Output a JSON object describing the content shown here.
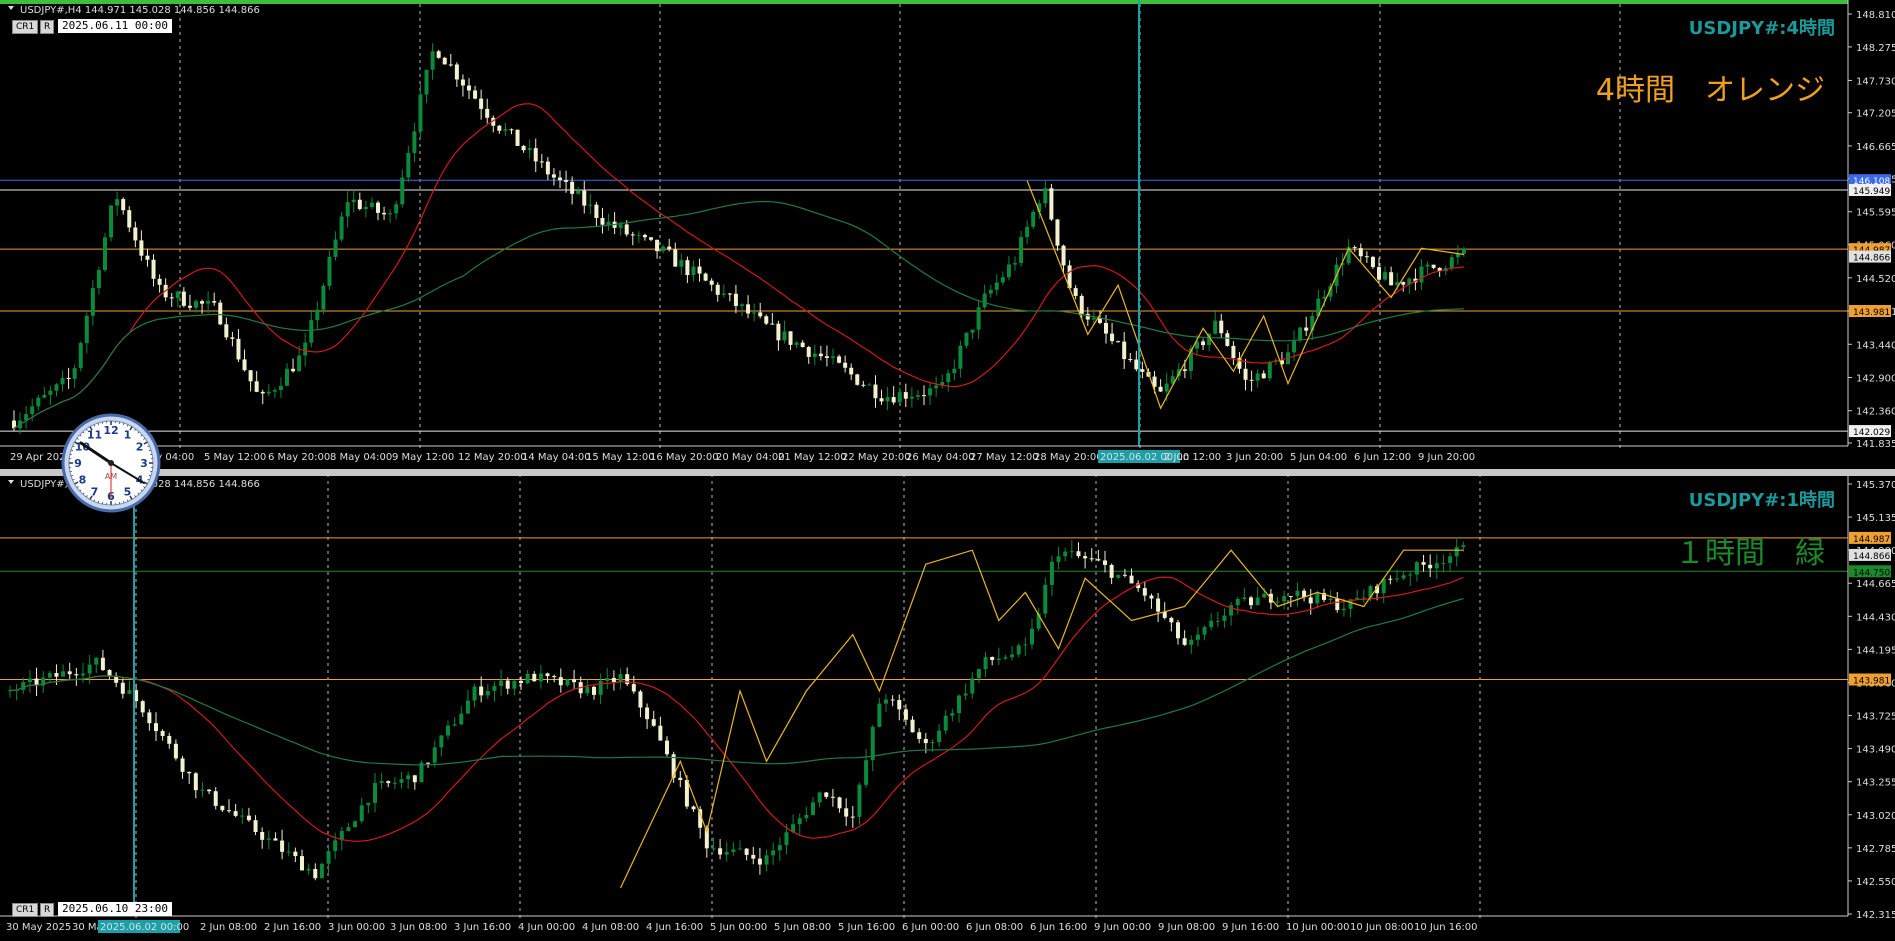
{
  "top": {
    "symbol_info": "USDJPY#,H4  144.971 145.028 144.856 144.866",
    "button_cr": "CR1",
    "button_r": "R",
    "time_box": "2025.06.11 00:00",
    "overlay_title": "USDJPY#:4時間",
    "overlay_note": "4時間　オレンジ",
    "prices": [
      "148.810",
      "148.275",
      "147.730",
      "147.205",
      "146.665",
      "146.135",
      "145.595",
      "145.060",
      "144.520",
      "143.981",
      "143.440",
      "142.900",
      "142.360",
      "141.835"
    ],
    "price_tags": {
      "blue": "146.108",
      "white_top": "145.949",
      "orange_top": "144.987",
      "current": "144.866",
      "orange_bot": "143.981",
      "white_bot": "142.029"
    },
    "dates": [
      "29 Apr 2025",
      "1 May 04:00",
      "5 May 12:00",
      "6 May 20:00",
      "8 May 04:00",
      "9 May 12:00",
      "12 May 20:00",
      "14 May 04:00",
      "15 May 12:00",
      "16 May 20:00",
      "20 May 04:00",
      "21 May 12:00",
      "22 May 20:00",
      "26 May 04:00",
      "27 May 12:00",
      "28 May 20:00",
      "2025.06.02 00:00",
      "2 Jun 12:00",
      "3 Jun 20:00",
      "5 Jun 04:00",
      "6 Jun 12:00",
      "9 Jun 20:00"
    ]
  },
  "bottom": {
    "symbol_info": "USDJPY#,H1  144.971 145.028 144.856 144.866",
    "button_cr": "CR1",
    "button_r": "R",
    "time_box": "2025.06.10 23:00",
    "overlay_title": "USDJPY#:1時間",
    "overlay_note": "１時間　緑",
    "prices": [
      "145.370",
      "145.135",
      "144.900",
      "144.665",
      "144.430",
      "144.195",
      "143.960",
      "143.725",
      "143.490",
      "143.255",
      "143.020",
      "142.785",
      "142.550",
      "142.315"
    ],
    "price_tags": {
      "orange_top": "144.987",
      "current": "144.866",
      "green": "144.750",
      "orange_bot": "143.981"
    },
    "dates": [
      "30 May 2025",
      "30 May 23:00",
      "2025.06.02 00:00",
      "2 Jun 08:00",
      "2 Jun 16:00",
      "3 Jun 00:00",
      "3 Jun 08:00",
      "3 Jun 16:00",
      "4 Jun 00:00",
      "4 Jun 08:00",
      "4 Jun 16:00",
      "5 Jun 00:00",
      "5 Jun 08:00",
      "5 Jun 16:00",
      "6 Jun 00:00",
      "6 Jun 08:00",
      "6 Jun 16:00",
      "9 Jun 00:00",
      "9 Jun 08:00",
      "9 Jun 16:00",
      "10 Jun 00:00",
      "10 Jun 08:00",
      "10 Jun 16:00"
    ]
  },
  "clock": {
    "label": "AM",
    "numbers": [
      "12",
      "1",
      "2",
      "3",
      "4",
      "5",
      "6",
      "7",
      "8",
      "9",
      "10",
      "11"
    ]
  },
  "colors": {
    "bg": "#000000",
    "bull": "#0a8a3a",
    "bear": "#f2f2d0",
    "ma_red": "#d01a1a",
    "ma_green": "#1e7a44",
    "zigzag": "#e8b820",
    "orange_line": "#f0a030",
    "blue_line": "#3a6ae8",
    "title_teal": "#1a9a9a",
    "note_orange": "#f0a020",
    "note_green": "#1a8a2a",
    "cursor": "#1aa0a8"
  }
}
